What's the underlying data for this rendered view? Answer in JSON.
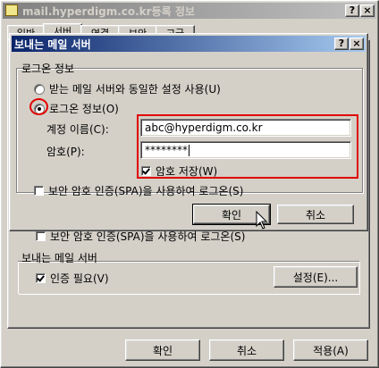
{
  "outer_window": {
    "title": "mail.hyperdigm.co.kr등록 정보",
    "tabs": [
      "일반",
      "서버",
      "연결",
      "보안",
      "고급"
    ],
    "spa_checkbox_label": "보안 암호 인증(SPA)을 사용하여 로그온(S)",
    "outgoing_group_title": "보내는 메일 서버",
    "auth_required_label": "인증 필요(V)",
    "settings_button": "설정(E)...",
    "ok_button": "확인",
    "cancel_button": "취소",
    "apply_button": "적용(A)"
  },
  "dialog": {
    "title": "보내는 메일 서버",
    "help_button": "?",
    "close_button": "×",
    "group_title": "로그온 정보",
    "radio_same": "받는 메일 서버와 동일한 설정 사용(U)",
    "radio_logon": "로그온 정보(O)",
    "account_label": "계정 이름(C):",
    "account_value": "abc@hyperdigm.co.kr",
    "password_label": "암호(P):",
    "password_value": "********",
    "save_password_label": "암호 저장(W)",
    "spa_label": "보안 암호 인증(SPA)을 사용하여 로그온(S)",
    "ok_button": "확인",
    "cancel_button": "취소"
  },
  "colors": {
    "titlebar_active_start": "#0a246a",
    "titlebar_active_end": "#a6caf0",
    "titlebar_inactive": "#808080",
    "highlight_red": "#e00000"
  }
}
